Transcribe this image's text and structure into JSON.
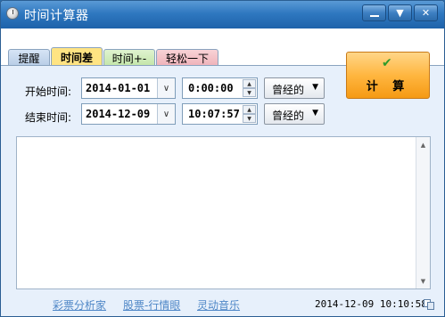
{
  "window": {
    "title": "时间计算器"
  },
  "tabs": [
    {
      "label": "提醒"
    },
    {
      "label": "时间差"
    },
    {
      "label": "时间+-"
    },
    {
      "label": "轻松一下"
    }
  ],
  "form": {
    "start": {
      "label": "开始时间:",
      "date": "2014-01-01",
      "time": "0:00:00",
      "mode": "曾经的"
    },
    "end": {
      "label": "结束时间:",
      "date": "2014-12-09",
      "time": "10:07:57",
      "mode": "曾经的"
    }
  },
  "calc_button": {
    "label": "计 算"
  },
  "result_text": "",
  "footer": {
    "links": [
      "彩票分析家",
      "股票-行情眼",
      "灵动音乐"
    ],
    "datetime": "2014-12-09  10:10:58"
  },
  "colors": {
    "titlebar": "#2f78c0",
    "active_tab": "#ffe483",
    "calc_button": "#ffb640",
    "panel": "#e7f0fb",
    "link": "#4f87c7"
  }
}
